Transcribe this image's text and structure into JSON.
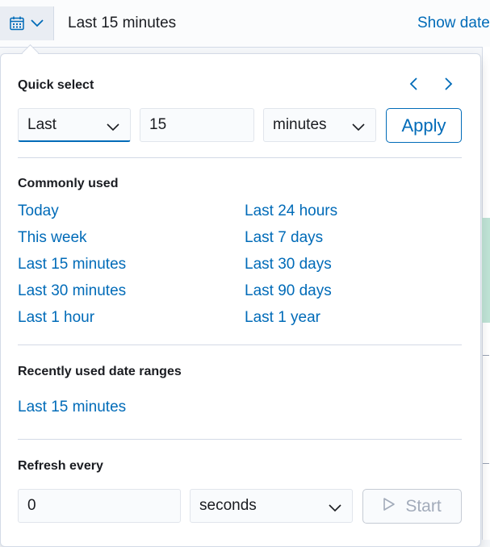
{
  "topbar": {
    "date_range": "Last 15 minutes",
    "show_dates_label": "Show dates",
    "calendar_icon": "calendar-icon",
    "chevron_icon": "chevron-down-icon"
  },
  "quick_select": {
    "title": "Quick select",
    "tense_value": "Last",
    "amount_value": "15",
    "unit_value": "minutes",
    "apply_label": "Apply",
    "prev_icon": "chevron-left-icon",
    "next_icon": "chevron-right-icon"
  },
  "commonly_used": {
    "title": "Commonly used",
    "left": [
      "Today",
      "This week",
      "Last 15 minutes",
      "Last 30 minutes",
      "Last 1 hour"
    ],
    "right": [
      "Last 24 hours",
      "Last 7 days",
      "Last 30 days",
      "Last 90 days",
      "Last 1 year"
    ]
  },
  "recent": {
    "title": "Recently used date ranges",
    "items": [
      "Last 15 minutes"
    ]
  },
  "refresh": {
    "title": "Refresh every",
    "interval_value": "0",
    "unit_value": "seconds",
    "start_label": "Start",
    "play_icon": "play-icon"
  },
  "colors": {
    "link": "#006bb8",
    "border": "#d3dae6",
    "text": "#1a1c21",
    "disabled": "#a2abba"
  }
}
